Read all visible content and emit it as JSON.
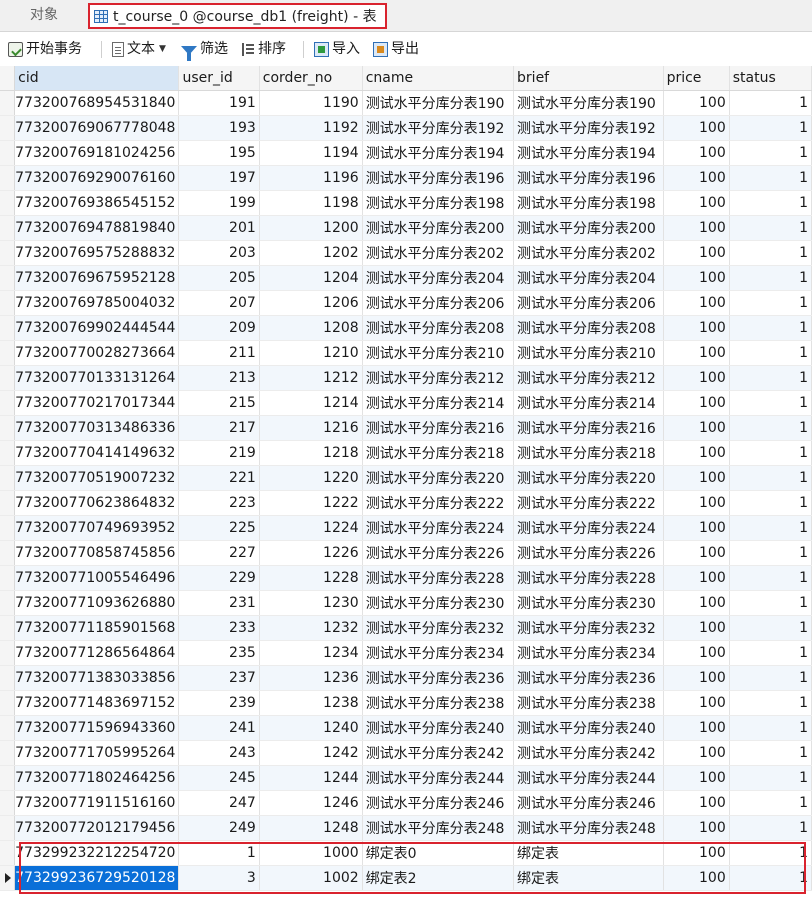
{
  "tabs": {
    "objects_label": "对象",
    "active_label": "t_course_0 @course_db1 (freight) - 表"
  },
  "toolbar": {
    "begin_transaction": "开始事务",
    "text": "文本",
    "filter": "筛选",
    "sort": "排序",
    "import": "导入",
    "export": "导出"
  },
  "columns": [
    "cid",
    "user_id",
    "corder_no",
    "cname",
    "brief",
    "price",
    "status"
  ],
  "rows": [
    {
      "cid": "773200768954531840",
      "user_id": "191",
      "corder_no": "1190",
      "cname": "测试水平分库分表190",
      "brief": "测试水平分库分表190",
      "price": "100",
      "status": "1"
    },
    {
      "cid": "773200769067778048",
      "user_id": "193",
      "corder_no": "1192",
      "cname": "测试水平分库分表192",
      "brief": "测试水平分库分表192",
      "price": "100",
      "status": "1"
    },
    {
      "cid": "773200769181024256",
      "user_id": "195",
      "corder_no": "1194",
      "cname": "测试水平分库分表194",
      "brief": "测试水平分库分表194",
      "price": "100",
      "status": "1"
    },
    {
      "cid": "773200769290076160",
      "user_id": "197",
      "corder_no": "1196",
      "cname": "测试水平分库分表196",
      "brief": "测试水平分库分表196",
      "price": "100",
      "status": "1"
    },
    {
      "cid": "773200769386545152",
      "user_id": "199",
      "corder_no": "1198",
      "cname": "测试水平分库分表198",
      "brief": "测试水平分库分表198",
      "price": "100",
      "status": "1"
    },
    {
      "cid": "773200769478819840",
      "user_id": "201",
      "corder_no": "1200",
      "cname": "测试水平分库分表200",
      "brief": "测试水平分库分表200",
      "price": "100",
      "status": "1"
    },
    {
      "cid": "773200769575288832",
      "user_id": "203",
      "corder_no": "1202",
      "cname": "测试水平分库分表202",
      "brief": "测试水平分库分表202",
      "price": "100",
      "status": "1"
    },
    {
      "cid": "773200769675952128",
      "user_id": "205",
      "corder_no": "1204",
      "cname": "测试水平分库分表204",
      "brief": "测试水平分库分表204",
      "price": "100",
      "status": "1"
    },
    {
      "cid": "773200769785004032",
      "user_id": "207",
      "corder_no": "1206",
      "cname": "测试水平分库分表206",
      "brief": "测试水平分库分表206",
      "price": "100",
      "status": "1"
    },
    {
      "cid": "773200769902444544",
      "user_id": "209",
      "corder_no": "1208",
      "cname": "测试水平分库分表208",
      "brief": "测试水平分库分表208",
      "price": "100",
      "status": "1"
    },
    {
      "cid": "773200770028273664",
      "user_id": "211",
      "corder_no": "1210",
      "cname": "测试水平分库分表210",
      "brief": "测试水平分库分表210",
      "price": "100",
      "status": "1"
    },
    {
      "cid": "773200770133131264",
      "user_id": "213",
      "corder_no": "1212",
      "cname": "测试水平分库分表212",
      "brief": "测试水平分库分表212",
      "price": "100",
      "status": "1"
    },
    {
      "cid": "773200770217017344",
      "user_id": "215",
      "corder_no": "1214",
      "cname": "测试水平分库分表214",
      "brief": "测试水平分库分表214",
      "price": "100",
      "status": "1"
    },
    {
      "cid": "773200770313486336",
      "user_id": "217",
      "corder_no": "1216",
      "cname": "测试水平分库分表216",
      "brief": "测试水平分库分表216",
      "price": "100",
      "status": "1"
    },
    {
      "cid": "773200770414149632",
      "user_id": "219",
      "corder_no": "1218",
      "cname": "测试水平分库分表218",
      "brief": "测试水平分库分表218",
      "price": "100",
      "status": "1"
    },
    {
      "cid": "773200770519007232",
      "user_id": "221",
      "corder_no": "1220",
      "cname": "测试水平分库分表220",
      "brief": "测试水平分库分表220",
      "price": "100",
      "status": "1"
    },
    {
      "cid": "773200770623864832",
      "user_id": "223",
      "corder_no": "1222",
      "cname": "测试水平分库分表222",
      "brief": "测试水平分库分表222",
      "price": "100",
      "status": "1"
    },
    {
      "cid": "773200770749693952",
      "user_id": "225",
      "corder_no": "1224",
      "cname": "测试水平分库分表224",
      "brief": "测试水平分库分表224",
      "price": "100",
      "status": "1"
    },
    {
      "cid": "773200770858745856",
      "user_id": "227",
      "corder_no": "1226",
      "cname": "测试水平分库分表226",
      "brief": "测试水平分库分表226",
      "price": "100",
      "status": "1"
    },
    {
      "cid": "773200771005546496",
      "user_id": "229",
      "corder_no": "1228",
      "cname": "测试水平分库分表228",
      "brief": "测试水平分库分表228",
      "price": "100",
      "status": "1"
    },
    {
      "cid": "773200771093626880",
      "user_id": "231",
      "corder_no": "1230",
      "cname": "测试水平分库分表230",
      "brief": "测试水平分库分表230",
      "price": "100",
      "status": "1"
    },
    {
      "cid": "773200771185901568",
      "user_id": "233",
      "corder_no": "1232",
      "cname": "测试水平分库分表232",
      "brief": "测试水平分库分表232",
      "price": "100",
      "status": "1"
    },
    {
      "cid": "773200771286564864",
      "user_id": "235",
      "corder_no": "1234",
      "cname": "测试水平分库分表234",
      "brief": "测试水平分库分表234",
      "price": "100",
      "status": "1"
    },
    {
      "cid": "773200771383033856",
      "user_id": "237",
      "corder_no": "1236",
      "cname": "测试水平分库分表236",
      "brief": "测试水平分库分表236",
      "price": "100",
      "status": "1"
    },
    {
      "cid": "773200771483697152",
      "user_id": "239",
      "corder_no": "1238",
      "cname": "测试水平分库分表238",
      "brief": "测试水平分库分表238",
      "price": "100",
      "status": "1"
    },
    {
      "cid": "773200771596943360",
      "user_id": "241",
      "corder_no": "1240",
      "cname": "测试水平分库分表240",
      "brief": "测试水平分库分表240",
      "price": "100",
      "status": "1"
    },
    {
      "cid": "773200771705995264",
      "user_id": "243",
      "corder_no": "1242",
      "cname": "测试水平分库分表242",
      "brief": "测试水平分库分表242",
      "price": "100",
      "status": "1"
    },
    {
      "cid": "773200771802464256",
      "user_id": "245",
      "corder_no": "1244",
      "cname": "测试水平分库分表244",
      "brief": "测试水平分库分表244",
      "price": "100",
      "status": "1"
    },
    {
      "cid": "773200771911516160",
      "user_id": "247",
      "corder_no": "1246",
      "cname": "测试水平分库分表246",
      "brief": "测试水平分库分表246",
      "price": "100",
      "status": "1"
    },
    {
      "cid": "773200772012179456",
      "user_id": "249",
      "corder_no": "1248",
      "cname": "测试水平分库分表248",
      "brief": "测试水平分库分表248",
      "price": "100",
      "status": "1"
    },
    {
      "cid": "773299232212254720",
      "user_id": "1",
      "corder_no": "1000",
      "cname": "绑定表0",
      "brief": "绑定表",
      "price": "100",
      "status": "1"
    },
    {
      "cid": "773299236729520128",
      "user_id": "3",
      "corder_no": "1002",
      "cname": "绑定表2",
      "brief": "绑定表",
      "price": "100",
      "status": "1"
    }
  ],
  "selected_row": 31,
  "colors": {
    "highlight": "#d9232e",
    "selection": "#0a6fd8",
    "alt_row": "#f2f7fc"
  }
}
